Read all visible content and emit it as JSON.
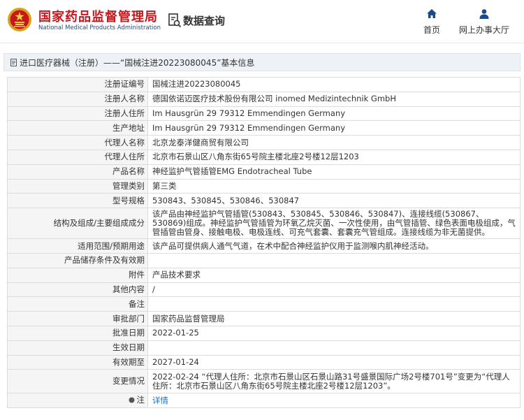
{
  "header": {
    "brand_cn": "国家药品监督管理局",
    "brand_en": "National Medical Products Administration",
    "data_query": "数据查询",
    "nav": {
      "home": "首页",
      "service": "网上办事大厅"
    },
    "accent": "#c8161d",
    "nav_icon_color": "#1a4a8a"
  },
  "breadcrumb": "进口医疗器械（注册）——“国械注进20223080045”基本信息",
  "rows": [
    {
      "label": "注册证编号",
      "value": "国械注进20223080045"
    },
    {
      "label": "注册人名称",
      "value": "德国依诺迈医疗技术股份有限公司 inomed Medizintechnik GmbH"
    },
    {
      "label": "注册人住所",
      "value": "Im Hausgrün 29 79312 Emmendingen Germany"
    },
    {
      "label": "生产地址",
      "value": "Im Hausgrün 29 79312 Emmendingen Germany"
    },
    {
      "label": "代理人名称",
      "value": "北京龙泰洋健商贸有限公司"
    },
    {
      "label": "代理人住所",
      "value": "北京市石景山区八角东街65号院主楼北座2号楼12层1203"
    },
    {
      "label": "产品名称",
      "value": "神经监护气管插管EMG Endotracheal Tube"
    },
    {
      "label": "管理类别",
      "value": "第三类"
    },
    {
      "label": "型号规格",
      "value": "530843、530845、530846、530847"
    },
    {
      "label": "结构及组成/主要组成成分",
      "value": "该产品由神经监护气管插管(530843、530845、530846、530847)、连接线缆(530867、530869)组成。神经监护气管插管为环氧乙烷灭菌、一次性使用，由气管插管、绿色表面电极组成，气管插管由管身、接触电极、电极连线、可充气套囊、套囊充气管组成。连接线缆为非无菌提供。"
    },
    {
      "label": "适用范围/预期用途",
      "value": "该产品可提供病人通气气道，在术中配合神经监护仪用于监测喉内肌神经活动。"
    },
    {
      "label": "产品储存条件及有效期",
      "value": ""
    },
    {
      "label": "附件",
      "value": "产品技术要求"
    },
    {
      "label": "其他内容",
      "value": "/"
    },
    {
      "label": "备注",
      "value": ""
    },
    {
      "label": "审批部门",
      "value": "国家药品监督管理局"
    },
    {
      "label": "批准日期",
      "value": "2022-01-25"
    },
    {
      "label": "生效日期",
      "value": ""
    },
    {
      "label": "有效期至",
      "value": "2027-01-24"
    },
    {
      "label": "变更情况",
      "value": "2022-02-24 “代理人住所：北京市石景山区石景山路31号盛景国际广场2号楼701号”变更为“代理人住所：北京市石景山区八角东街65号院主楼北座2号楼12层1203”。"
    },
    {
      "label": "注",
      "value": "详情"
    }
  ]
}
